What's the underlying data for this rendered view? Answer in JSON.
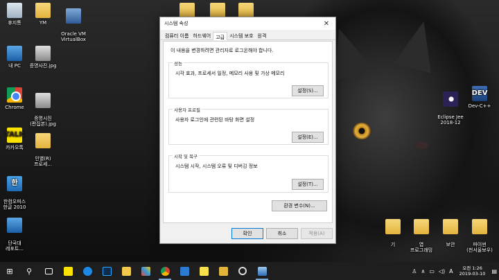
{
  "desktop": {
    "left_icons": [
      {
        "label": "휴지통"
      },
      {
        "label": "YM"
      },
      {
        "label": "Oracle VM\nVirtualBox"
      },
      {
        "label": "내 PC"
      },
      {
        "label": "증명사진.jpg"
      },
      {
        "label": "Chrome"
      },
      {
        "label": "증명시진\n(편집본).jpg"
      },
      {
        "label": "카카오톡"
      },
      {
        "label": "인별(R)\n프로세..."
      },
      {
        "label": "한컴오피스\n한글 2010"
      },
      {
        "label": "단국대\n레포트..."
      }
    ],
    "right_icons": [
      {
        "label": "Eclipse Jee\n2018-12"
      },
      {
        "label": "Dev-C++"
      }
    ],
    "bottom_folders": [
      {
        "label": "기"
      },
      {
        "label": "엽\n프로그래밍"
      },
      {
        "label": "보안"
      },
      {
        "label": "파이썬\n(천서울보우)"
      }
    ]
  },
  "dialog": {
    "title": "시스템 속성",
    "close_glyph": "✕",
    "tabs": [
      {
        "label": "컴퓨터 이름"
      },
      {
        "label": "하드웨어"
      },
      {
        "label": "고급"
      },
      {
        "label": "시스템 보호"
      },
      {
        "label": "원격"
      }
    ],
    "note": "이 내용을 변경하려면 관리자로 로그온해야 합니다.",
    "performance": {
      "title": "성능",
      "desc": "시각 효과, 프로세서 일정, 메모리 사용 및 가상 메모리",
      "button": "설정(S)..."
    },
    "user_profile": {
      "title": "사용자 프로필",
      "desc": "사용자 로그인에 관련된 바탕 화면 설정",
      "button": "설정(E)..."
    },
    "startup": {
      "title": "시작 및 복구",
      "desc": "시스템 시작, 시스템 오류 및 디버깅 정보",
      "button": "설정(T)..."
    },
    "env_button": "환경 변수(N)...",
    "ok": "확인",
    "cancel": "취소",
    "apply": "적용(A)"
  },
  "taskbar": {
    "start_glyph": "⊞",
    "search_glyph": "⚲",
    "tray": {
      "people_glyph": "♙",
      "chevron": "∧",
      "network": "▭",
      "volume": "◁)",
      "ime": "A",
      "time": "오전 1:26",
      "date": "2019-03-10",
      "notify": "▤"
    }
  }
}
